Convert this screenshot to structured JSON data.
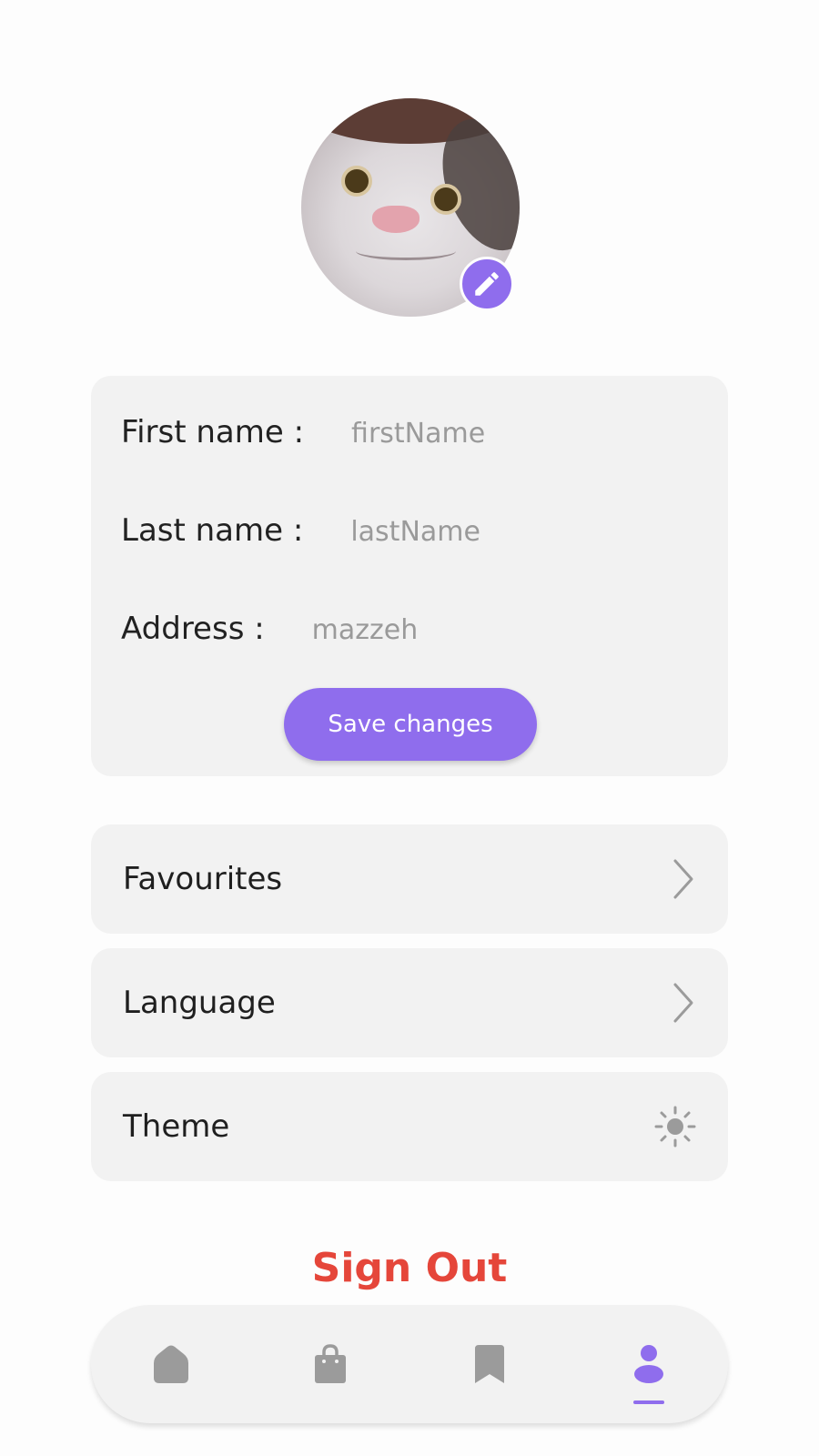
{
  "profile": {
    "avatar_alt": "Profile photo",
    "edit_icon": "pencil-icon"
  },
  "form": {
    "first_name_label": "First name :",
    "first_name_placeholder": "firstName",
    "last_name_label": "Last name :",
    "last_name_placeholder": "lastName",
    "address_label": "Address :",
    "address_placeholder": "mazzeh",
    "save_label": "Save changes"
  },
  "menu": [
    {
      "label": "Favourites",
      "icon": "chevron-right-icon"
    },
    {
      "label": "Language",
      "icon": "chevron-right-icon"
    },
    {
      "label": "Theme",
      "icon": "sun-icon"
    }
  ],
  "sign_out_label": "Sign Out",
  "nav": {
    "items": [
      {
        "icon": "home-icon",
        "active": false
      },
      {
        "icon": "shopping-bag-icon",
        "active": false
      },
      {
        "icon": "bookmark-icon",
        "active": false
      },
      {
        "icon": "profile-icon",
        "active": true
      }
    ]
  },
  "colors": {
    "accent": "#8f6ded",
    "danger": "#e5463a",
    "card": "#f2f2f2",
    "icon_inactive": "#9b9b9b"
  }
}
